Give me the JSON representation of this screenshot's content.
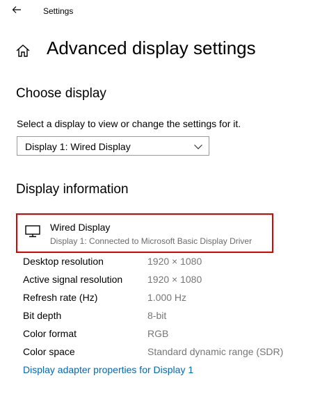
{
  "window": {
    "title": "Settings",
    "back_icon": "back-arrow-icon"
  },
  "header": {
    "home_icon": "home-icon",
    "title": "Advanced display settings"
  },
  "choose_display": {
    "heading": "Choose display",
    "description": "Select a display to view or change the settings for it.",
    "selected": "Display 1: Wired Display",
    "chevron_icon": "chevron-down-icon"
  },
  "display_info": {
    "heading": "Display information",
    "card": {
      "icon": "monitor-icon",
      "name": "Wired Display",
      "subtitle": "Display 1: Connected to Microsoft Basic Display Driver",
      "highlight_color": "#e00000"
    },
    "rows": [
      {
        "label": "Desktop resolution",
        "value": "1920 × 1080"
      },
      {
        "label": "Active signal resolution",
        "value": "1920 × 1080"
      },
      {
        "label": "Refresh rate (Hz)",
        "value": "1.000 Hz"
      },
      {
        "label": "Bit depth",
        "value": "8-bit"
      },
      {
        "label": "Color format",
        "value": "RGB"
      },
      {
        "label": "Color space",
        "value": "Standard dynamic range (SDR)"
      }
    ],
    "adapter_link": "Display adapter properties for Display 1"
  },
  "colors": {
    "link": "#0067c0",
    "secondary_text": "#767676"
  }
}
